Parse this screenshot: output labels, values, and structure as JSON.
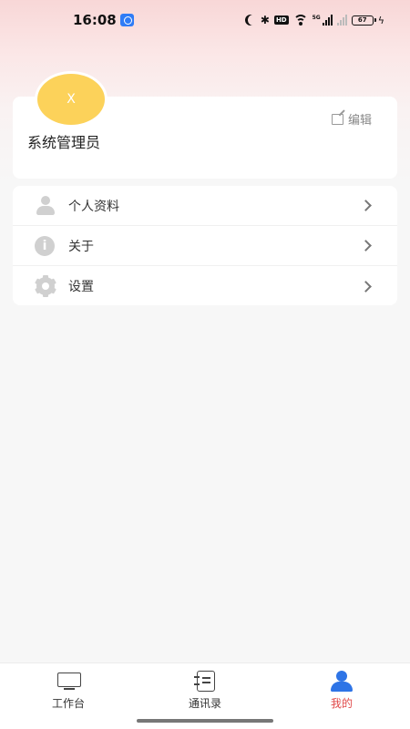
{
  "status_bar": {
    "time": "16:08",
    "network": "5G",
    "hd": "HD",
    "battery": "67"
  },
  "profile": {
    "avatar_text": "X",
    "name": "系统管理员",
    "edit_label": "编辑",
    "avatar_color": "#fcd25a"
  },
  "menu": {
    "items": [
      {
        "label": "个人资料",
        "icon": "person-icon"
      },
      {
        "label": "关于",
        "icon": "info-icon"
      },
      {
        "label": "设置",
        "icon": "gear-icon"
      }
    ]
  },
  "bottom_nav": {
    "items": [
      {
        "label": "工作台",
        "icon": "monitor-icon",
        "active": false
      },
      {
        "label": "通讯录",
        "icon": "contacts-book-icon",
        "active": false
      },
      {
        "label": "我的",
        "icon": "user-icon",
        "active": true
      }
    ],
    "active_color": "#e04848",
    "active_icon_color": "#2e74e6"
  }
}
